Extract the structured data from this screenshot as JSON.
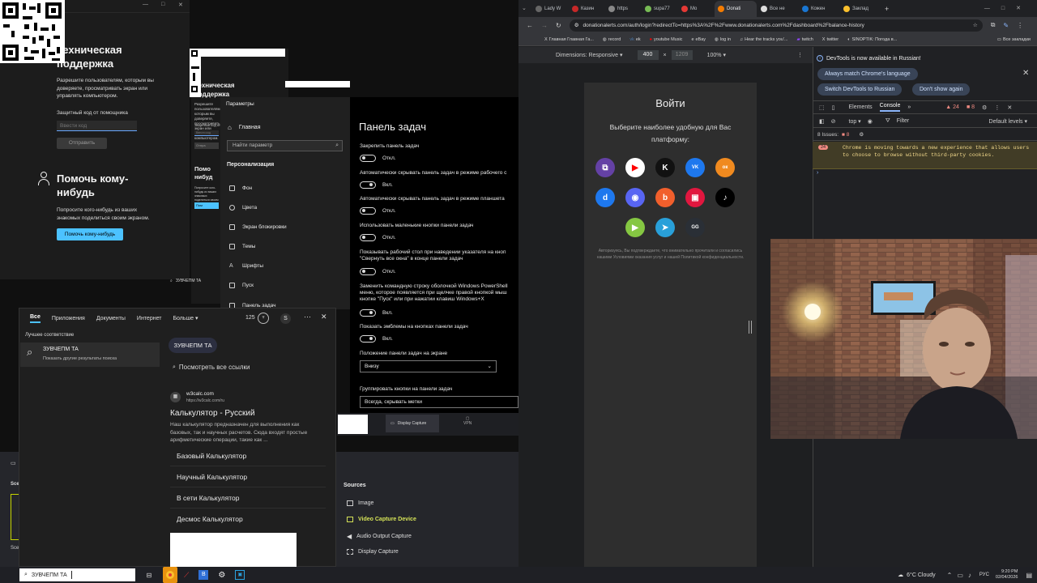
{
  "qa_window": {
    "title": "Техническая поддержка",
    "desc": "Разрешите пользователям, которым вы доверяете, просматривать экран или управлять компьютером.",
    "code_label": "Защитный код от помощника",
    "code_placeholder": "Ввести код",
    "submit": "Отправить",
    "help_title": "Помочь кому-нибудь",
    "help_desc": "Попросите кого-нибудь из ваших знакомых поделиться своим экраном.",
    "help_button": "Помочь кому-нибудь"
  },
  "qa_window_dup": {
    "title": "Техническая поддержка",
    "desc": "Разрешите пользователям, которым вы доверяете, просматривать экран или управлять компьютером.",
    "code_label": "Защитный код от помощника",
    "code_placeholder": "Ввести код",
    "submit": "Отпра",
    "help_title": "Помо нибуд",
    "help_desc": "Попросите кого-нибудь из ваших знакомых поделиться своим экраном.",
    "help_button": "Пом"
  },
  "settings": {
    "title": "Параметры",
    "home": "Главная",
    "search_placeholder": "Найти параметр",
    "section": "Персонализация",
    "menu": [
      "Фон",
      "Цвета",
      "Экран блокировки",
      "Темы",
      "Шрифты",
      "Пуск",
      "Панель задач"
    ],
    "page_title": "Панель задач",
    "rows": [
      {
        "label": "Закрепить панель задач",
        "state": "Откл."
      },
      {
        "label": "Автоматически скрывать панель задач в режиме рабочего с",
        "state": "Вкл."
      },
      {
        "label": "Автоматически скрывать панель задач в режиме планшета",
        "state": "Откл."
      },
      {
        "label": "Использовать маленькие кнопки панели задач",
        "state": "Откл."
      },
      {
        "label": "Показывать рабочий стол при наведении указателя на кноп \"Свернуть все окна\" в конце панели задач",
        "state": "Откл."
      },
      {
        "label": "Заменить командную строку оболочкой Windows PowerShell меню, которое появляется при щелчке правой кнопкой мыш кнопке \"Пуск\" или при нажатии клавиш Windows+X",
        "state": "Вкл."
      },
      {
        "label": "Показать эмблемы на кнопках панели задач",
        "state": "Вкл."
      }
    ],
    "position_label": "Положение панели задач на экране",
    "position_value": "Внизу",
    "group_label": "Группировать кнопки на панели задач",
    "group_value": "Всегда, скрывать метки"
  },
  "search_panel": {
    "tabs": [
      "Все",
      "Приложения",
      "Документы",
      "Интернет",
      "Больше ▾"
    ],
    "points": "125",
    "avatar": "S",
    "best_match": "Лучшее соответствие",
    "result_title": "ЗУВЧЕПМ ТА",
    "result_sub": "Показать другие результаты поиска",
    "query_chip": "ЗУВЧЕПМ ТА",
    "see_all": "Посмотреть все ссылки",
    "site": "w3calc.com",
    "site_url": "https://w3calc.com/ru",
    "web_title": "Калькулятор - Русский",
    "web_desc": "Наш калькулятор предназначен для выполнения как базовых, так и научных расчетов. Сюда входят простые арифметические операции, такие как ...",
    "links": [
      "Базовый Калькулятор",
      "Научный Калькулятор",
      "В сети Калькулятор",
      "Десмос Калькулятор"
    ],
    "dup_result": "ЗУВЧЕПМ ТА"
  },
  "obs": {
    "display_capture_tab": "Display Capture",
    "vpn": "VPN",
    "sources_title": "Sources",
    "sources": [
      {
        "name": "Image",
        "active": false
      },
      {
        "name": "Video Capture Device",
        "active": true
      },
      {
        "name": "Audio Output Capture",
        "active": false
      },
      {
        "name": "Display Capture",
        "active": false
      }
    ],
    "scenes_short": "Sce",
    "scenes_short2": "Sce"
  },
  "chrome": {
    "tabs": [
      "Lady W",
      "Казин",
      "https",
      "supa77",
      "Mo",
      "Donati",
      "Все не",
      "Кожен",
      "Заклад"
    ],
    "active_tab_index": 5,
    "url": "donationalerts.com/auth/login?redirectTo=https%3A%2F%2Fwww.donationalerts.com%2Fdashboard%2Fbalance-history",
    "bookmarks": [
      "Главная Главная Га...",
      "record",
      "ek",
      "youtube Music",
      "eBay",
      "log in",
      "Hear the tracks you'...",
      "twitch",
      "twitter",
      "SINOPTIK: Погода в..."
    ],
    "bookmarks_all": "Все закладки",
    "device": {
      "dimensions": "Dimensions: Responsive ▾",
      "width": "400",
      "height": "1209",
      "zoom": "100% ▾"
    }
  },
  "login_card": {
    "title": "Войти",
    "subtitle": "Выберите наиболее удобную для Вас платформу:",
    "platforms": [
      {
        "name": "twitch",
        "glyph": "⧉",
        "color": "#6441a5"
      },
      {
        "name": "youtube",
        "glyph": "▶",
        "color": "#ffffff"
      },
      {
        "name": "kick",
        "glyph": "K",
        "color": "#111111"
      },
      {
        "name": "vk",
        "glyph": "VK",
        "color": "#1e78ee"
      },
      {
        "name": "ok",
        "glyph": "ок",
        "color": "#f08a1f"
      },
      {
        "name": "donationalerts",
        "glyph": "d",
        "color": "#1e78ee"
      },
      {
        "name": "discord",
        "glyph": "◉",
        "color": "#5865f2"
      },
      {
        "name": "boosty",
        "glyph": "b",
        "color": "#f15f2c"
      },
      {
        "name": "trovo",
        "glyph": "▣",
        "color": "#e1173f"
      },
      {
        "name": "tiktok",
        "glyph": "♪",
        "color": "#000000"
      },
      {
        "name": "rumble",
        "glyph": "▶",
        "color": "#85c742"
      },
      {
        "name": "telegram",
        "glyph": "➤",
        "color": "#29a0d9"
      },
      {
        "name": "goodgame",
        "glyph": "GG",
        "color": "#2a2f36"
      }
    ],
    "terms": "Авторизуясь, Вы подтверждаете, что внимательно прочитали и согласились нашими Условиями оказания услуг и нашей Политикой конфиденциальности."
  },
  "devtools": {
    "banner": "DevTools is now available in Russian!",
    "btn1": "Always match Chrome's language",
    "btn2": "Switch DevTools to Russian",
    "btn3": "Don't show again",
    "tabs": [
      "Elements",
      "Console"
    ],
    "active_tab": "Console",
    "warn_count": "24",
    "err_count": "8",
    "context": "top ▾",
    "filter_placeholder": "Filter",
    "levels": "Default levels ▾",
    "issues": "8 Issues:",
    "issues_count": "8",
    "msg_badge": "24",
    "message": "Chrome is moving towards a new experience that allows users to choose to browse without third-party cookies."
  },
  "taskbar": {
    "search_text": "ЗУВЧЕПМ ТА",
    "weather": "6°C Cloudy",
    "lang": "РУС",
    "time": "9:20 PM",
    "date": "02/04/2026"
  }
}
